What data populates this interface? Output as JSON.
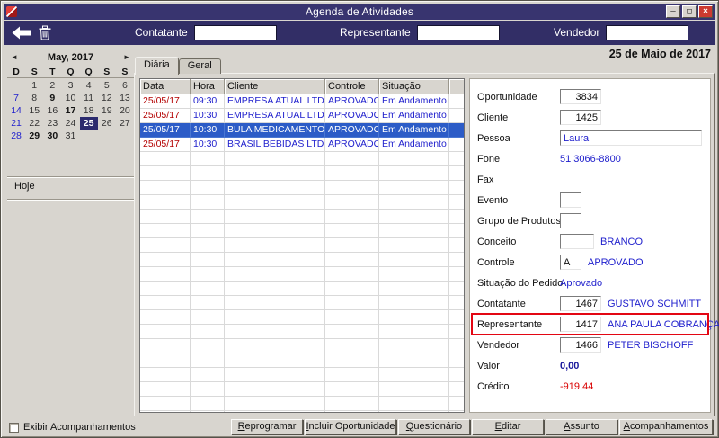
{
  "window": {
    "title": "Agenda de Atividades",
    "controls": {
      "minimize": "–",
      "maximize": "□",
      "close": "×"
    }
  },
  "icons": {
    "back": "left-arrow-icon",
    "delete": "trash-icon"
  },
  "toolbar": {
    "fields": [
      {
        "label": "Contatante",
        "value": ""
      },
      {
        "label": "Representante",
        "value": ""
      },
      {
        "label": "Vendedor",
        "value": ""
      }
    ]
  },
  "date_heading": "25 de Maio de 2017",
  "calendar": {
    "prev": "◄",
    "next": "►",
    "month_label": "May, 2017",
    "day_headers": [
      "D",
      "S",
      "T",
      "Q",
      "Q",
      "S",
      "S"
    ],
    "weeks": [
      [
        "",
        "1",
        "2",
        "3",
        "4",
        "5",
        "6"
      ],
      [
        "7",
        "8",
        "9",
        "10",
        "11",
        "12",
        "13"
      ],
      [
        "14",
        "15",
        "16",
        "17",
        "18",
        "19",
        "20"
      ],
      [
        "21",
        "22",
        "23",
        "24",
        "25",
        "26",
        "27"
      ],
      [
        "28",
        "29",
        "30",
        "31",
        "",
        "",
        ""
      ]
    ],
    "selected_day": "25",
    "bold_days": [
      "9",
      "17",
      "29",
      "30"
    ],
    "sunday_days": [
      "7",
      "14",
      "21",
      "28"
    ],
    "today_label": "Hoje"
  },
  "tabs": [
    {
      "label": "Diária",
      "active": true
    },
    {
      "label": "Geral",
      "active": false
    }
  ],
  "activities_table": {
    "columns": [
      "Data",
      "Hora",
      "Cliente",
      "Controle",
      "Situação"
    ],
    "rows": [
      {
        "cells": [
          "25/05/17",
          "09:30",
          "EMPRESA ATUAL LTDA",
          "APROVADO",
          "Em Andamento"
        ],
        "selected": false
      },
      {
        "cells": [
          "25/05/17",
          "10:30",
          "EMPRESA ATUAL LTDA",
          "APROVADO",
          "Em Andamento"
        ],
        "selected": false
      },
      {
        "cells": [
          "25/05/17",
          "10:30",
          "BULA MEDICAMENTOS LTDA",
          "APROVADO",
          "Em Andamento"
        ],
        "selected": true
      },
      {
        "cells": [
          "25/05/17",
          "10:30",
          "BRASIL BEBIDAS LTDA",
          "APROVADO",
          "Em Andamento"
        ],
        "selected": false
      }
    ]
  },
  "detail_form": {
    "rows": [
      {
        "label": "Oportunidade",
        "box": {
          "value": "3834",
          "kind": "num"
        }
      },
      {
        "label": "Cliente",
        "box": {
          "value": "1425",
          "kind": "num"
        }
      },
      {
        "label": "Pessoa",
        "box": {
          "value": "Laura",
          "kind": "wide"
        }
      },
      {
        "label": "Fone",
        "text": {
          "value": "51 3066-8800",
          "kind": "blue"
        }
      },
      {
        "label": "Fax"
      },
      {
        "label": "Evento",
        "box": {
          "value": "",
          "kind": "tiny"
        }
      },
      {
        "label": "Grupo de Produtos",
        "box": {
          "value": "",
          "kind": "tiny"
        }
      },
      {
        "label": "Conceito",
        "box": {
          "value": "",
          "kind": "code"
        },
        "text": {
          "value": "BRANCO",
          "kind": "blue"
        }
      },
      {
        "label": "Controle",
        "box": {
          "value": "A",
          "kind": "tiny"
        },
        "text": {
          "value": "APROVADO",
          "kind": "blue"
        }
      },
      {
        "label": "Situação do Pedido",
        "text": {
          "value": "Aprovado",
          "kind": "blue"
        }
      },
      {
        "label": "Contatante",
        "box": {
          "value": "1467",
          "kind": "num"
        },
        "text": {
          "value": "GUSTAVO SCHMITT",
          "kind": "blue"
        }
      },
      {
        "label": "Representante",
        "box": {
          "value": "1417",
          "kind": "num"
        },
        "text": {
          "value": "ANA PAULA COBRANÇAS S.A.",
          "kind": "blue"
        },
        "annotated": true
      },
      {
        "label": "Vendedor",
        "box": {
          "value": "1466",
          "kind": "num"
        },
        "text": {
          "value": "PETER BISCHOFF",
          "kind": "blue"
        }
      },
      {
        "label": "Valor",
        "text": {
          "value": "0,00",
          "kind": "bold"
        }
      },
      {
        "label": "Crédito",
        "text": {
          "value": "-919,44",
          "kind": "red"
        }
      }
    ]
  },
  "action_buttons": [
    {
      "label": "Reprogramar"
    },
    {
      "label": "Incluir Oportunidade"
    },
    {
      "label": "Questionário"
    },
    {
      "label": "Editar"
    },
    {
      "label": "Assunto"
    },
    {
      "label": "Acompanhamentos"
    }
  ],
  "footer": {
    "checkbox_label": "Exibir Acompanhamentos",
    "checked": false
  },
  "colors": {
    "titlebar": "#38346f",
    "toolbar": "#322e66",
    "window_bg": "#d8d5cf",
    "highlight": "#2c5cc7",
    "link_blue": "#2121cd",
    "date_red": "#b40000",
    "credit_red": "#d90000",
    "annotation_red": "#e30613",
    "selected_day_bg": "#2b2a6e"
  }
}
